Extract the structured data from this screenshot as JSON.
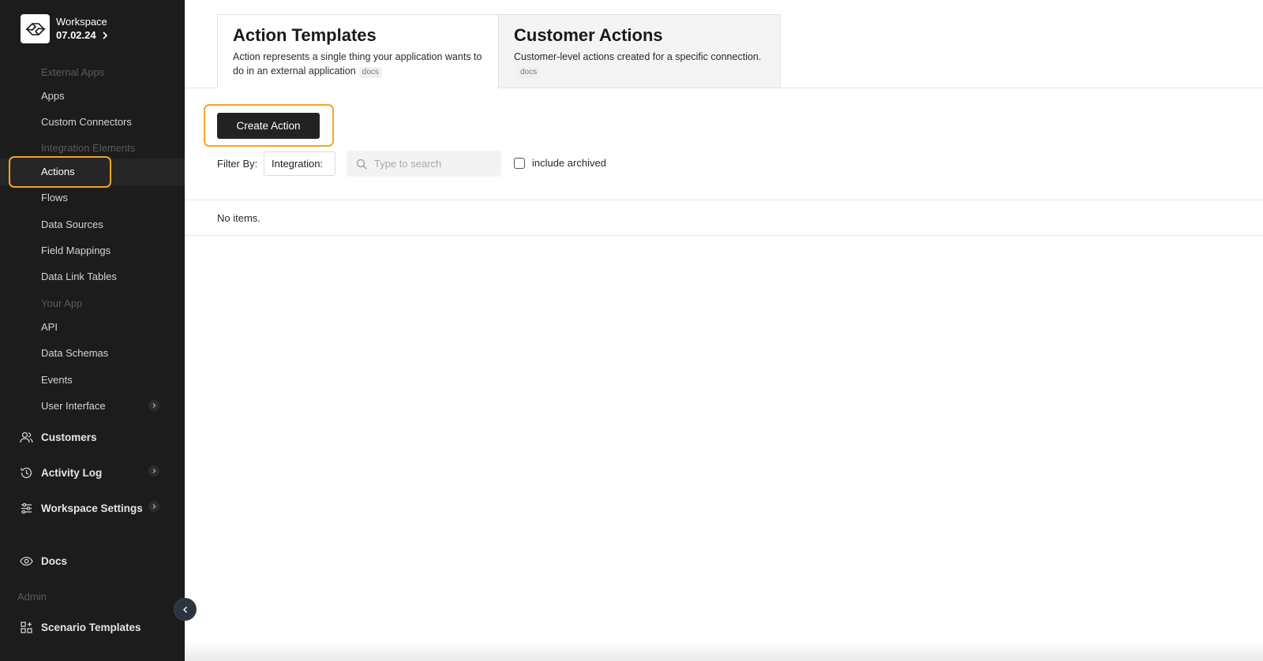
{
  "workspace": {
    "name": "Workspace",
    "version": "07.02.24"
  },
  "sidebar": {
    "sections": {
      "external_apps": "External Apps",
      "integration_elements": "Integration Elements",
      "your_app": "Your App",
      "admin": "Admin"
    },
    "items": {
      "apps": "Apps",
      "custom_connectors": "Custom Connectors",
      "actions": "Actions",
      "flows": "Flows",
      "data_sources": "Data Sources",
      "field_mappings": "Field Mappings",
      "data_link_tables": "Data Link Tables",
      "api": "API",
      "data_schemas": "Data Schemas",
      "events": "Events",
      "user_interface": "User Interface"
    },
    "main_items": {
      "customers": "Customers",
      "activity_log": "Activity Log",
      "workspace_settings": "Workspace Settings",
      "docs": "Docs",
      "scenario_templates": "Scenario Templates"
    },
    "active_item": "Actions"
  },
  "tabs": [
    {
      "title": "Action Templates",
      "description": "Action represents a single thing your application wants to do in an external application",
      "badge": "docs"
    },
    {
      "title": "Customer Actions",
      "description": "Customer-level actions created for a specific connection.",
      "badge": "docs"
    }
  ],
  "toolbar": {
    "create_label": "Create Action",
    "filter_label": "Filter By:",
    "filter_value": "Integration:",
    "search_placeholder": "Type to search",
    "include_archived_label": "include archived"
  },
  "list": {
    "empty_text": "No items."
  },
  "colors": {
    "sidebar_bg": "#1c1c1c",
    "highlight": "#f5a623",
    "button_bg": "#222222"
  }
}
